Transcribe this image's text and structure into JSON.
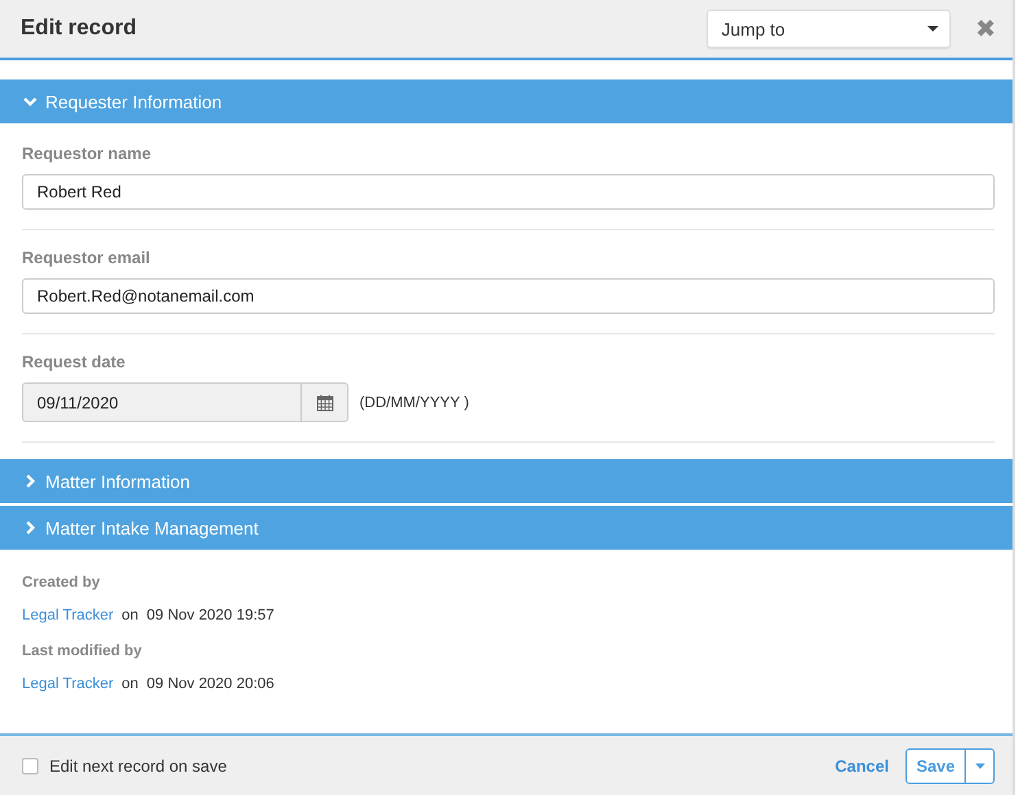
{
  "window": {
    "title": "Edit record",
    "close_icon": "✖"
  },
  "jump_to": {
    "value": "Jump to"
  },
  "sections": [
    {
      "title": "Requester Information",
      "expanded": true,
      "fields": [
        {
          "kind": "text",
          "label": "Requestor name",
          "value": "Robert Red"
        },
        {
          "kind": "text",
          "label": "Requestor email",
          "value": "Robert.Red@notanemail.com"
        },
        {
          "kind": "date",
          "label": "Request date",
          "value": "09/11/2020",
          "hint": "(DD/MM/YYYY )",
          "disabled": true
        }
      ]
    },
    {
      "title": "Matter Information",
      "expanded": false
    },
    {
      "title": "Matter Intake Management",
      "expanded": false
    }
  ],
  "audit": [
    {
      "label": "Created by",
      "user": "Legal Tracker",
      "on": "on",
      "when": "09 Nov 2020 19:57"
    },
    {
      "label": "Last modified by",
      "user": "Legal Tracker",
      "on": "on",
      "when": "09 Nov 2020 20:06"
    }
  ],
  "footer": {
    "checkbox": {
      "label": "Edit next record on save",
      "checked": false
    },
    "cancel": "Cancel",
    "save": "Save"
  }
}
